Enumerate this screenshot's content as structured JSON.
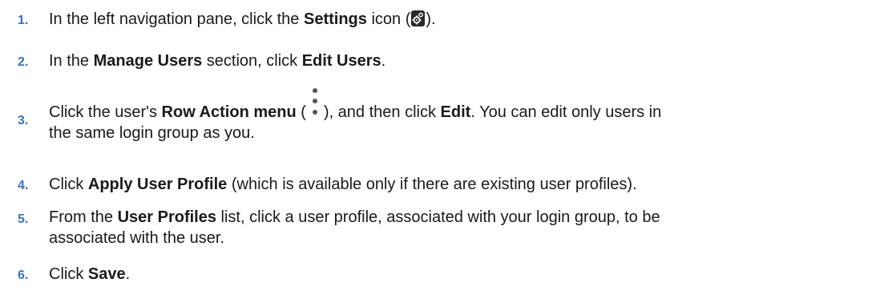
{
  "steps": [
    {
      "number": "1.",
      "parts": [
        "In the left navigation pane, click the ",
        "Settings",
        " icon (",
        ")."
      ]
    },
    {
      "number": "2.",
      "parts": [
        "In the ",
        "Manage Users",
        " section, click ",
        "Edit Users",
        "."
      ]
    },
    {
      "number": "3.",
      "parts": [
        "Click the user's ",
        "Row Action menu",
        " (",
        "), and then click ",
        "Edit",
        ". You can edit only users in",
        "the same login group as you."
      ]
    },
    {
      "number": "4.",
      "parts": [
        "Click ",
        "Apply User Profile",
        " (which is available only if there are existing user profiles)."
      ]
    },
    {
      "number": "5.",
      "parts": [
        "From the ",
        "User Profiles",
        " list, click a user profile, associated with your login group, to be",
        "associated with the user."
      ]
    },
    {
      "number": "6.",
      "parts": [
        "Click ",
        "Save",
        "."
      ]
    }
  ],
  "icons": {
    "settings": "gear-icon",
    "row_action": "kebab-icon"
  }
}
